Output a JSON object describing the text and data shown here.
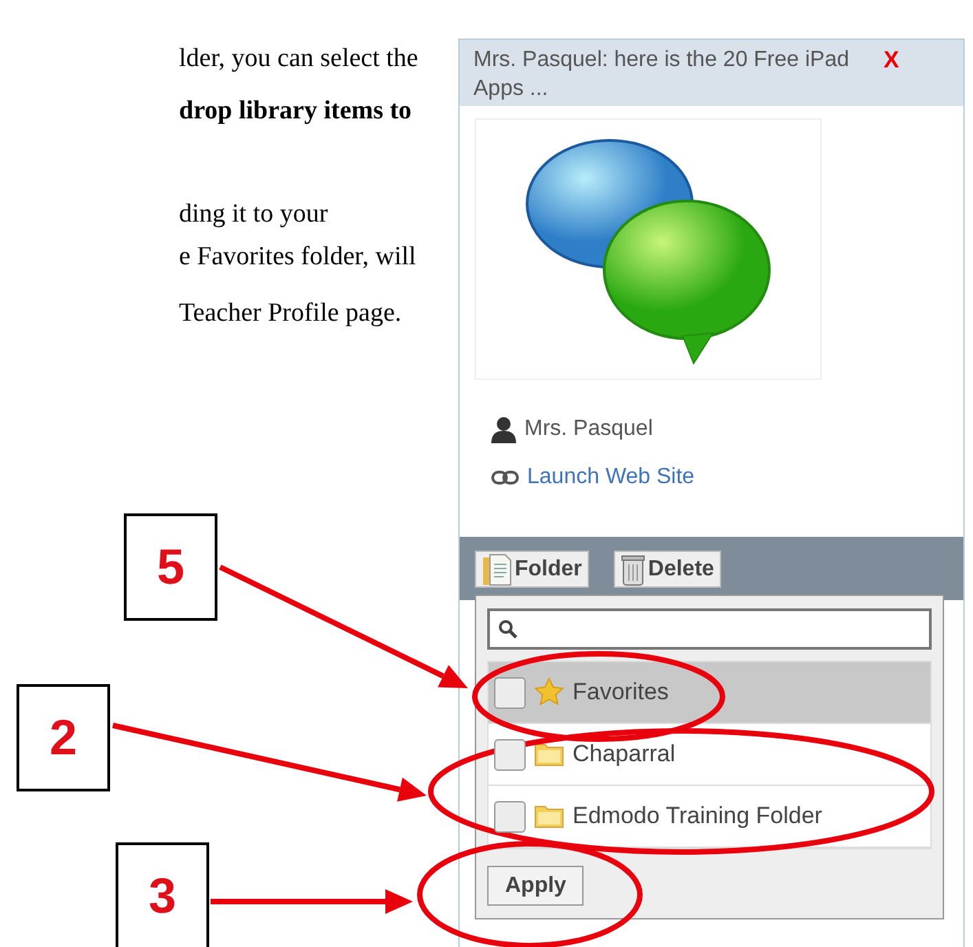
{
  "document_text": [
    {
      "text": "lder, you can select the",
      "kind": "plain"
    },
    {
      "text": "drop library items to",
      "kind": "bold"
    },
    {
      "text": "ding it to your",
      "kind": "plain"
    },
    {
      "text": "e Favorites folder, will",
      "kind": "plain"
    },
    {
      "text": "Teacher Profile page.",
      "kind": "plain"
    }
  ],
  "panel": {
    "title": "Mrs. Pasquel: here is the 20 Free iPad Apps ...",
    "close": "X",
    "author": "Mrs. Pasquel",
    "link": "Launch Web Site",
    "toolbar": [
      {
        "label": "Folder",
        "kind": "folder"
      },
      {
        "label": "Delete",
        "kind": "delete"
      }
    ],
    "folder_menu": {
      "items": [
        {
          "label": "Favorites",
          "kind": "star",
          "checked": false,
          "selected": true
        },
        {
          "label": "Chaparral",
          "kind": "folder",
          "checked": false,
          "selected": false
        },
        {
          "label": "Edmodo Training Folder",
          "kind": "folder",
          "checked": false,
          "selected": false
        }
      ],
      "button": "Apply"
    }
  },
  "callouts": [
    {
      "label": "5"
    },
    {
      "label": "2"
    },
    {
      "label": "3"
    }
  ]
}
